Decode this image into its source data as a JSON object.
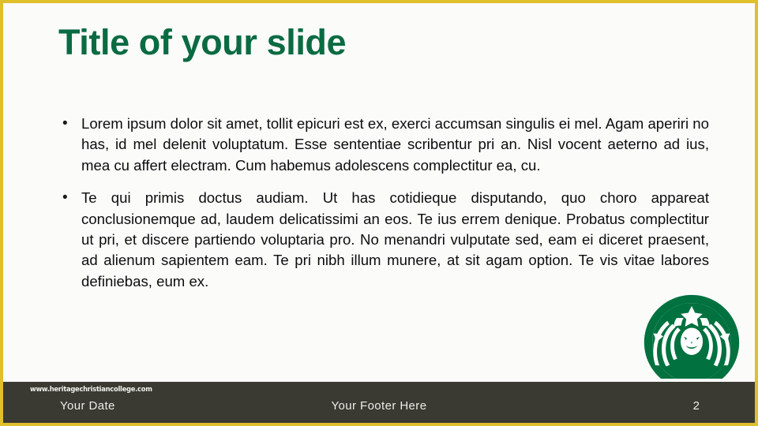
{
  "slide": {
    "title": "Title of your slide",
    "bullet_char": "•",
    "bullets": [
      "Lorem ipsum dolor sit amet, tollit epicuri est ex, exerci accumsan singulis ei mel. Agam aperiri no has, id mel delenit voluptatum. Esse sententiae scribentur pri an. Nisl vocent aeterno ad ius, mea cu affert electram. Cum habemus adolescens complectitur ea, cu.",
      "Te qui primis doctus audiam. Ut has cotidieque disputando, quo choro appareat conclusionemque ad, laudem delicatissimi an eos. Te ius errem denique. Probatus complectitur ut pri, et discere partiendo voluptaria pro. No menandri vulputate sed, eam ei diceret praesent, ad alienum sapientem eam. Te pri nibh illum munere, at sit agam option. Te vis vitae labores definiebas, eum ex."
    ]
  },
  "logo": {
    "name": "starbucks-siren-logo",
    "color": "#00713f"
  },
  "footer": {
    "website": "www.heritagechristiancollege.com",
    "date": "Your Date",
    "center": "Your Footer Here",
    "page_number": "2"
  },
  "colors": {
    "border_gold": "#dfbf2c",
    "title_green": "#0a6b42",
    "footer_bar": "#3a3a33",
    "background": "#fbfbfa",
    "body_text": "#0d0d0d",
    "footer_text": "#ecece8"
  }
}
